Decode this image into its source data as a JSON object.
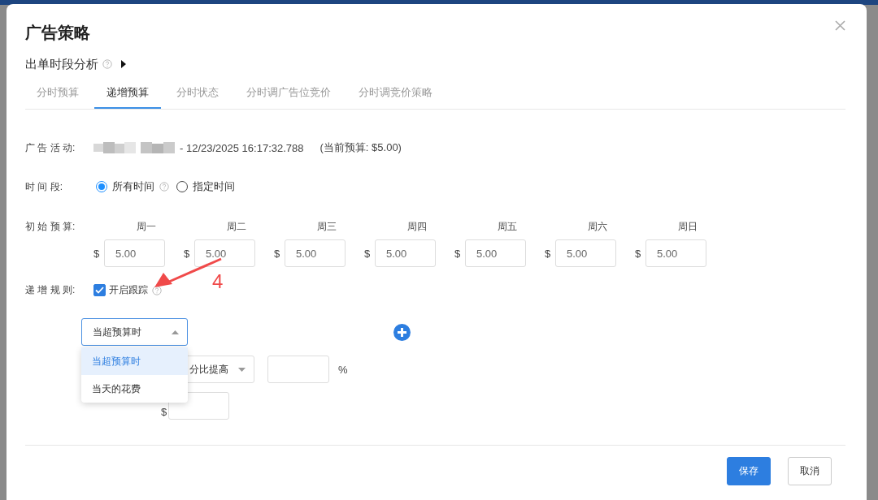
{
  "dialog": {
    "title": "广告策略",
    "subtitle": "出单时段分析",
    "tabs": [
      {
        "label": "分时预算",
        "selected": false
      },
      {
        "label": "递增预算",
        "selected": true
      },
      {
        "label": "分时状态",
        "selected": false
      },
      {
        "label": "分时调广告位竞价",
        "selected": false
      },
      {
        "label": "分时调竞价策略",
        "selected": false
      }
    ]
  },
  "form": {
    "campaign_label": "广 告 活 动:",
    "campaign_value": "- 12/23/2025 16:17:32.788",
    "current_budget": "(当前预算: $5.00)",
    "period_label": "时 间 段:",
    "period_options": [
      {
        "label": "所有时间",
        "selected": true,
        "help": true
      },
      {
        "label": "指定时间",
        "selected": false,
        "help": false
      }
    ],
    "budget_label": "初 始 预 算:",
    "days": [
      {
        "day": "周一",
        "currency": "$",
        "value": "5.00"
      },
      {
        "day": "周二",
        "currency": "$",
        "value": "5.00"
      },
      {
        "day": "周三",
        "currency": "$",
        "value": "5.00"
      },
      {
        "day": "周四",
        "currency": "$",
        "value": "5.00"
      },
      {
        "day": "周五",
        "currency": "$",
        "value": "5.00"
      },
      {
        "day": "周六",
        "currency": "$",
        "value": "5.00"
      },
      {
        "day": "周日",
        "currency": "$",
        "value": "5.00"
      }
    ],
    "rule_label": "递 增 规 则:",
    "tracking": {
      "label": "开启跟踪",
      "checked": true
    },
    "condition_select": {
      "value": "当超预算时",
      "expanded": true,
      "options": [
        {
          "label": "当超预算时",
          "selected": true
        },
        {
          "label": "当天的花费",
          "selected": false
        }
      ]
    },
    "mode_select": {
      "value": "分比提高"
    },
    "percent_unit": "%",
    "max_currency": "$"
  },
  "annotation": {
    "text": "4"
  },
  "buttons": [
    {
      "label": "保存",
      "kind": "primary"
    },
    {
      "label": "取消",
      "kind": "default"
    }
  ]
}
